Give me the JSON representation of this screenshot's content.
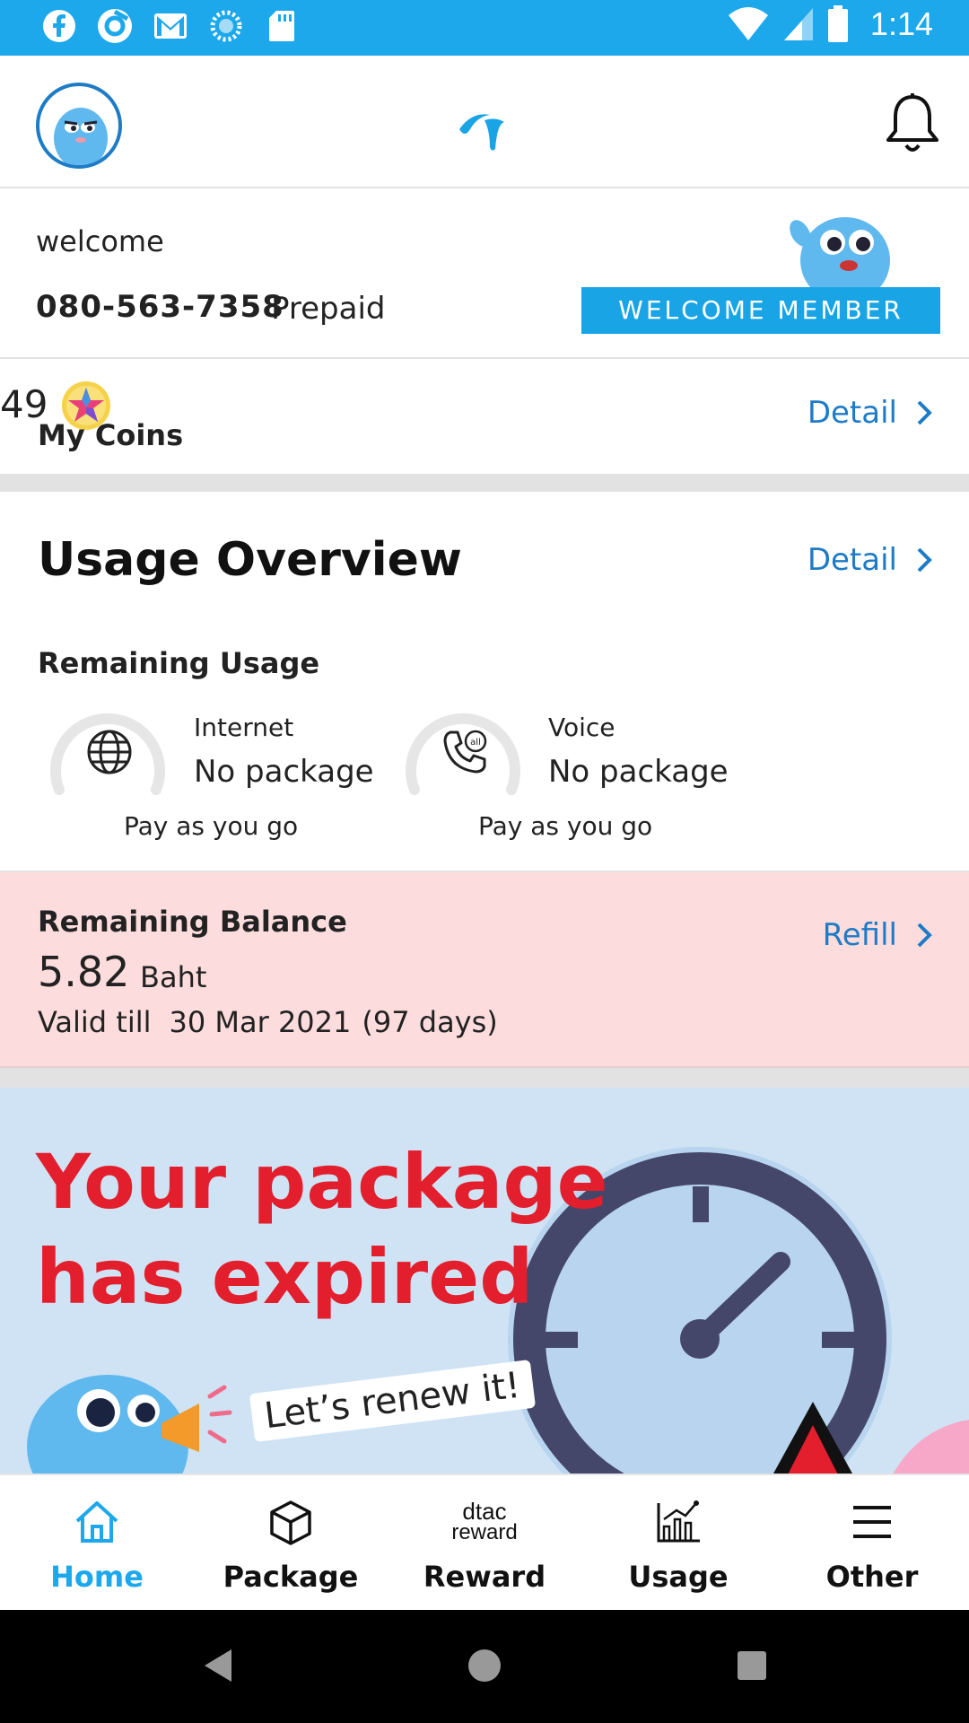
{
  "status_bar": {
    "time": "1:14",
    "left_icons": [
      "facebook-icon",
      "browser-icon",
      "gmail-icon",
      "loading-icon",
      "sd-card-icon"
    ],
    "right_icons": [
      "wifi-icon",
      "signal-icon",
      "battery-icon"
    ]
  },
  "header": {
    "avatar_icon": "mascot-avatar-icon",
    "logo_icon": "dtac-logo-icon",
    "bell_icon": "bell-icon"
  },
  "welcome": {
    "greeting": "welcome",
    "phone_number": "080-563-7358",
    "plan_type": "Prepaid",
    "member_banner": "WELCOME MEMBER"
  },
  "coins": {
    "count": "49",
    "label": "My Coins",
    "detail_label": "Detail"
  },
  "usage_overview": {
    "title": "Usage Overview",
    "detail_label": "Detail",
    "remaining_title": "Remaining Usage",
    "items": [
      {
        "label": "Internet",
        "value": "No package",
        "note": "Pay as you go",
        "icon": "globe-icon"
      },
      {
        "label": "Voice",
        "value": "No package",
        "note": "Pay as you go",
        "icon": "phone-icon"
      }
    ]
  },
  "balance": {
    "title": "Remaining Balance",
    "amount": "5.82",
    "unit": "Baht",
    "valid_label": "Valid till",
    "valid_date": "30 Mar 2021",
    "valid_days": "(97 days)",
    "refill_label": "Refill"
  },
  "promo": {
    "headline_line1": "Your package",
    "headline_line2": "has expired",
    "tagline": "Let’s renew it!"
  },
  "bottom_nav": {
    "items": [
      {
        "label": "Home",
        "icon": "home-icon",
        "active": true
      },
      {
        "label": "Package",
        "icon": "box-icon",
        "active": false
      },
      {
        "label": "Reward",
        "icon": "dtac-reward-icon",
        "active": false
      },
      {
        "label": "Usage",
        "icon": "chart-icon",
        "active": false
      },
      {
        "label": "Other",
        "icon": "menu-icon",
        "active": false
      }
    ],
    "reward_icon_text_top": "dtac",
    "reward_icon_text_bottom": "reward"
  },
  "colors": {
    "primary": "#1da8ec",
    "link": "#1e7bc6",
    "alert_red": "#e31e2d",
    "balance_bg": "#fddcdd",
    "promo_bg": "#cfe3f4"
  }
}
